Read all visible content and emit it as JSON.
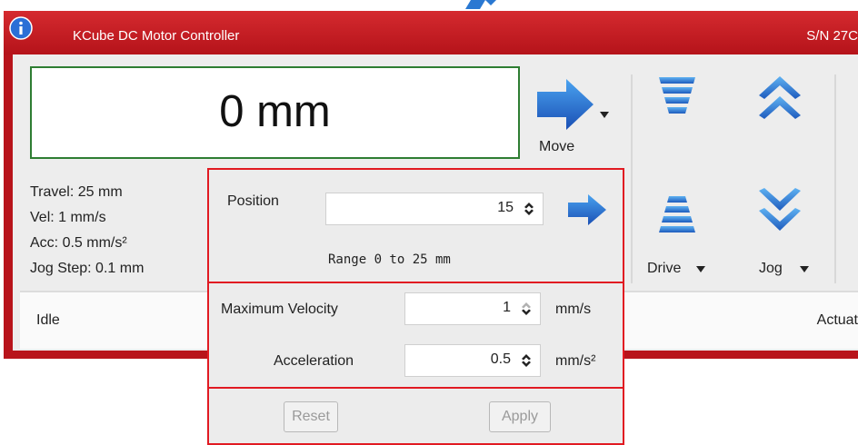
{
  "window": {
    "title": "KCube DC Motor Controller",
    "serial": "S/N 27C",
    "accent_color": "#c8181f"
  },
  "display": {
    "position": "0 mm",
    "border_color": "#2e7d32"
  },
  "toolbar": {
    "move_label": "Move",
    "drive_label": "Drive",
    "jog_label": "Jog"
  },
  "settings": {
    "travel": "Travel: 25 mm",
    "vel": "Vel: 1 mm/s",
    "acc": "Acc: 0.5 mm/s²",
    "jog_step": "Jog Step: 0.1 mm"
  },
  "status": {
    "state": "Idle",
    "right": "Actuat"
  },
  "position_popup": {
    "label": "Position",
    "value": "15",
    "range": "Range 0 to 25 mm"
  },
  "velocity_popup": {
    "max_velocity_label": "Maximum Velocity",
    "max_velocity_value": "1",
    "max_velocity_unit": "mm/s",
    "acceleration_label": "Acceleration",
    "acceleration_value": "0.5",
    "acceleration_unit": "mm/s²"
  },
  "buttons": {
    "reset": "Reset",
    "apply": "Apply"
  },
  "icons": {
    "info": "info-icon",
    "move": "arrow-right-icon",
    "drive_up": "drive-up-icon",
    "drive_down": "drive-down-icon",
    "jog_up": "jog-up-icon",
    "jog_down": "jog-down-icon"
  }
}
